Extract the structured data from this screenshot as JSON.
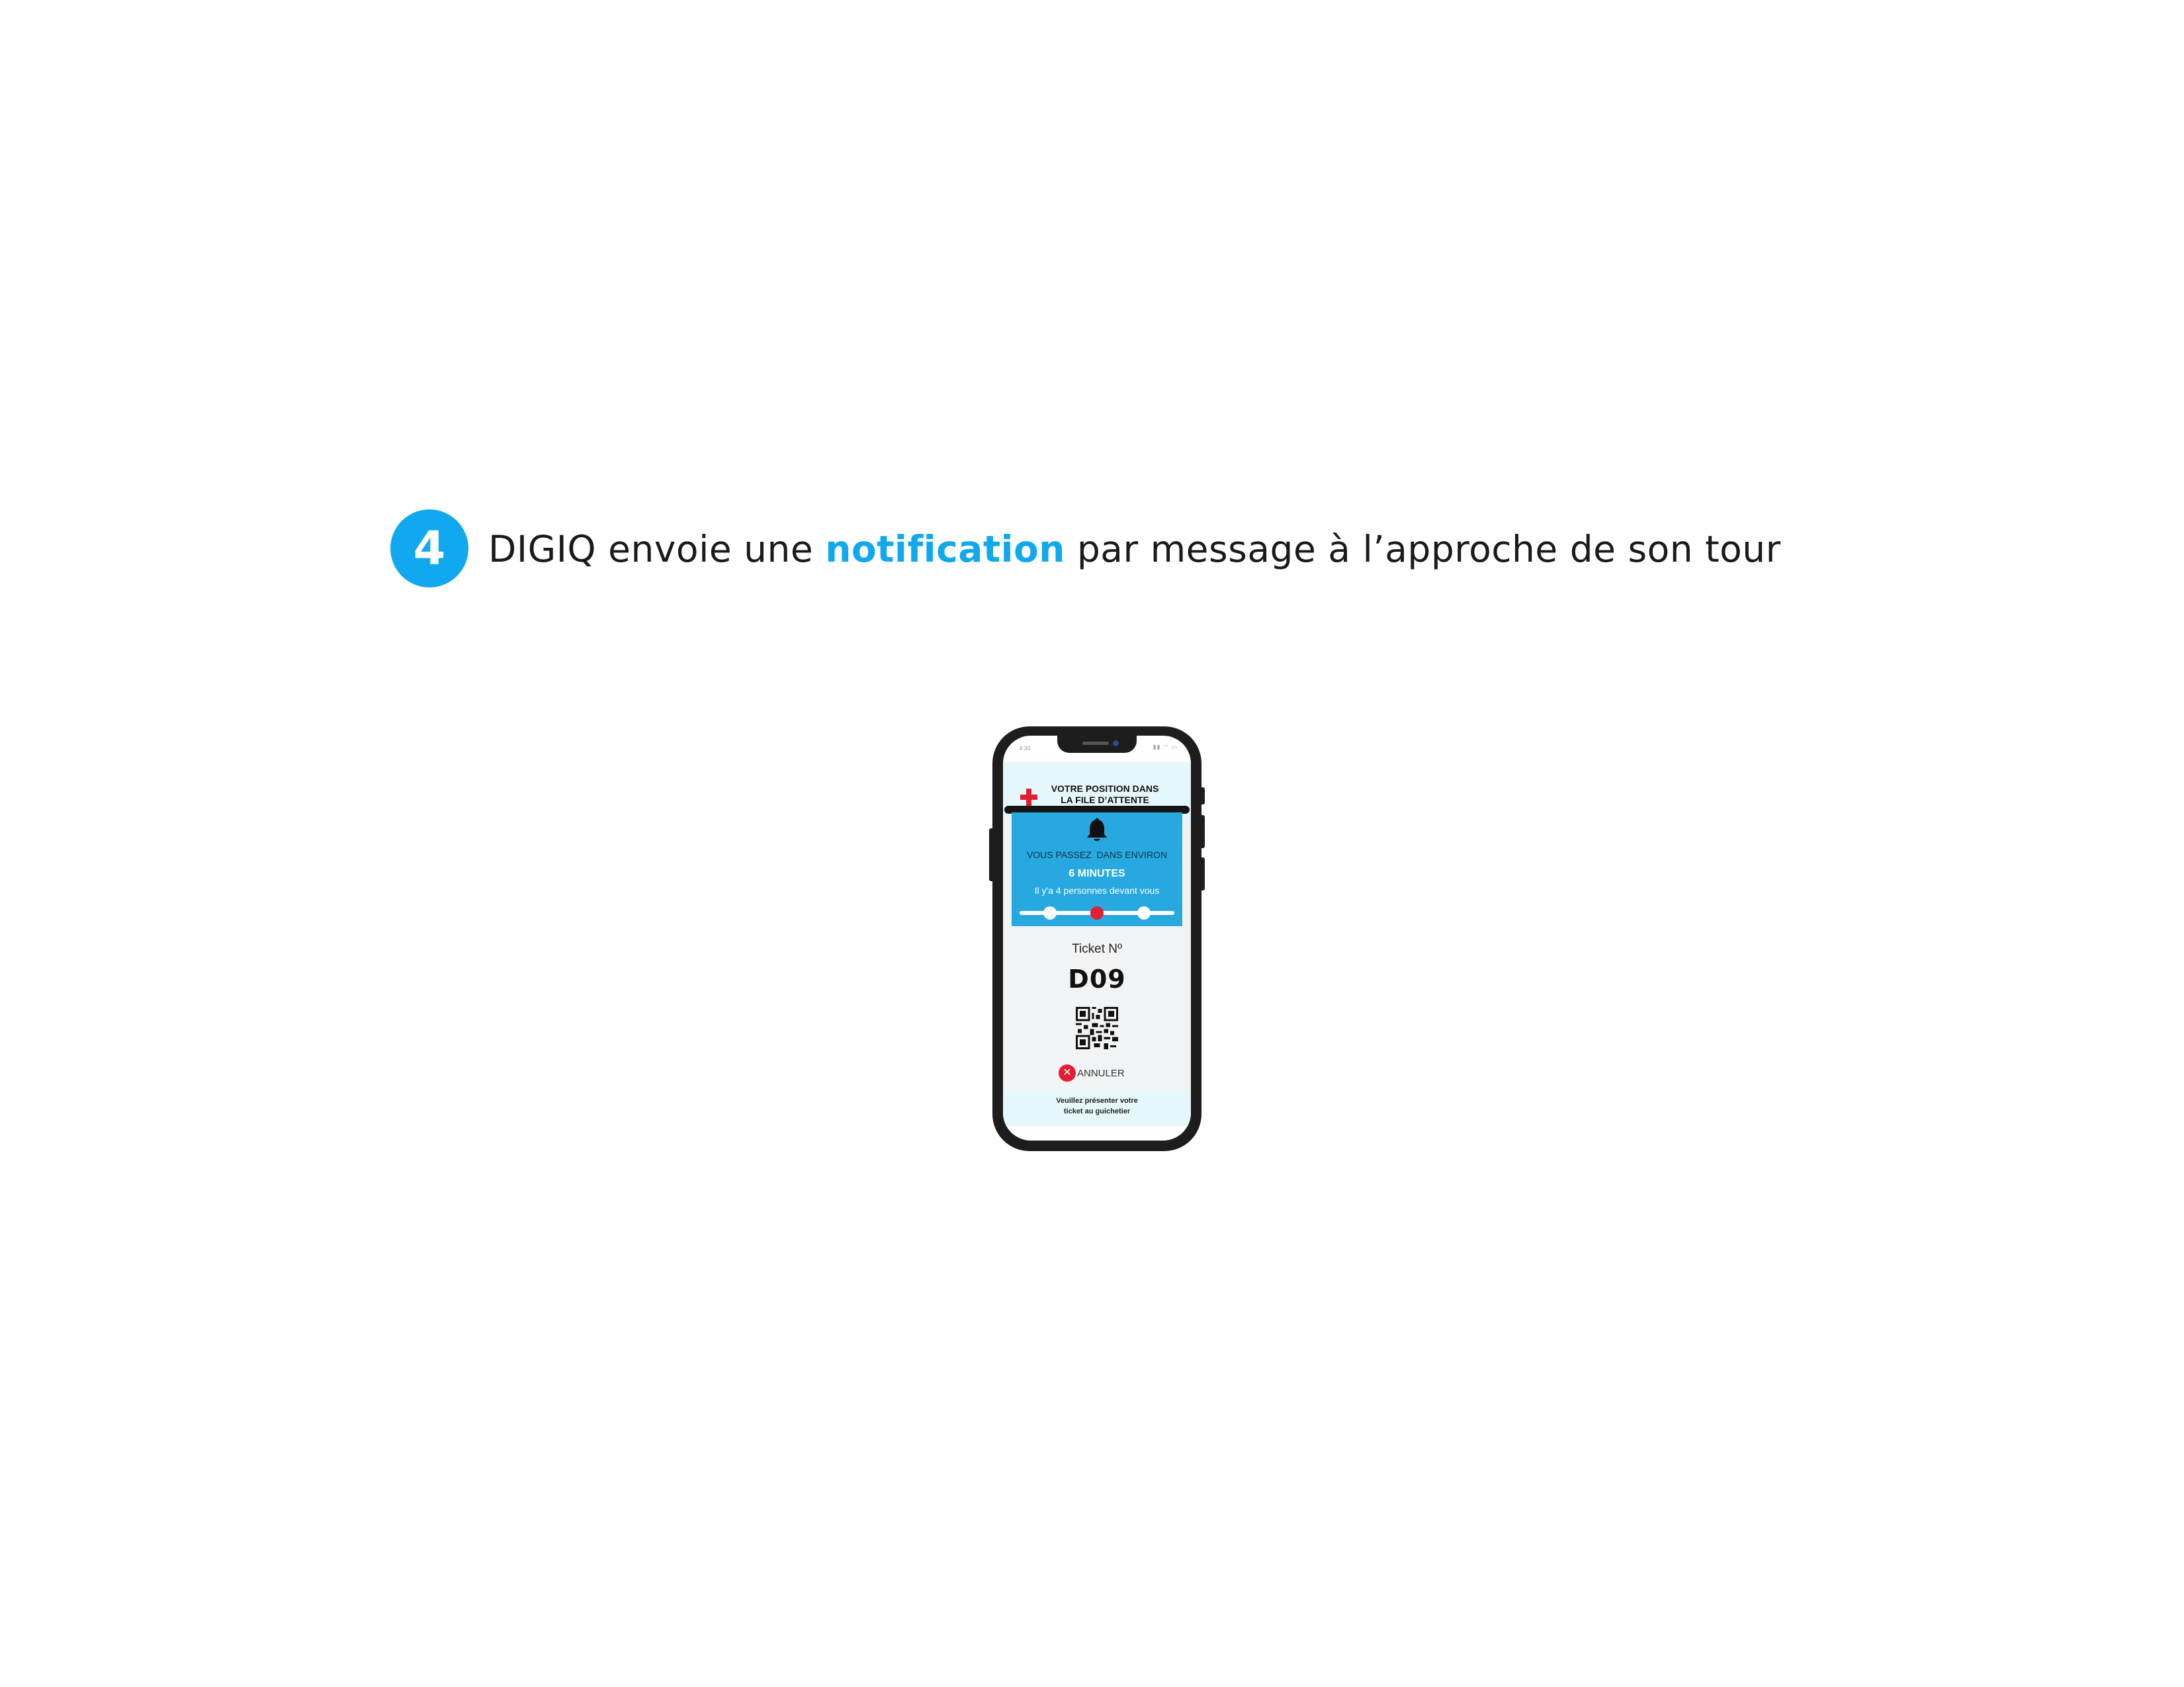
{
  "headline": {
    "step_number": "4",
    "text_before": "DIGIQ envoie une ",
    "highlight": "notification",
    "text_after": " par message à l’approche de son tour"
  },
  "phone": {
    "status": {
      "time": "4:30",
      "icons": "▮▮ ◠ ▭"
    },
    "header": {
      "title_line1": "VOTRE POSITION DANS",
      "title_line2": "LA FILE D’ATTENTE",
      "logo": "red-cross-icon"
    },
    "notification": {
      "icon": "bell-icon",
      "line1": "VOUS PASSEZ  DANS ENVIRON",
      "minutes": "6 MINUTES",
      "people": "Il y'a 4 personnes devant vous"
    },
    "ticket": {
      "label": "Ticket Nº",
      "number": "D09",
      "cancel_label": "ANNULER"
    },
    "footer": {
      "line1": "Veuillez présenter votre",
      "line2": "ticket au guichetier"
    }
  },
  "colors": {
    "accent": "#10a8ee",
    "notification_bg": "#27a9e0",
    "brand_red": "#e21e35",
    "phone_body": "#1d1d1d"
  }
}
